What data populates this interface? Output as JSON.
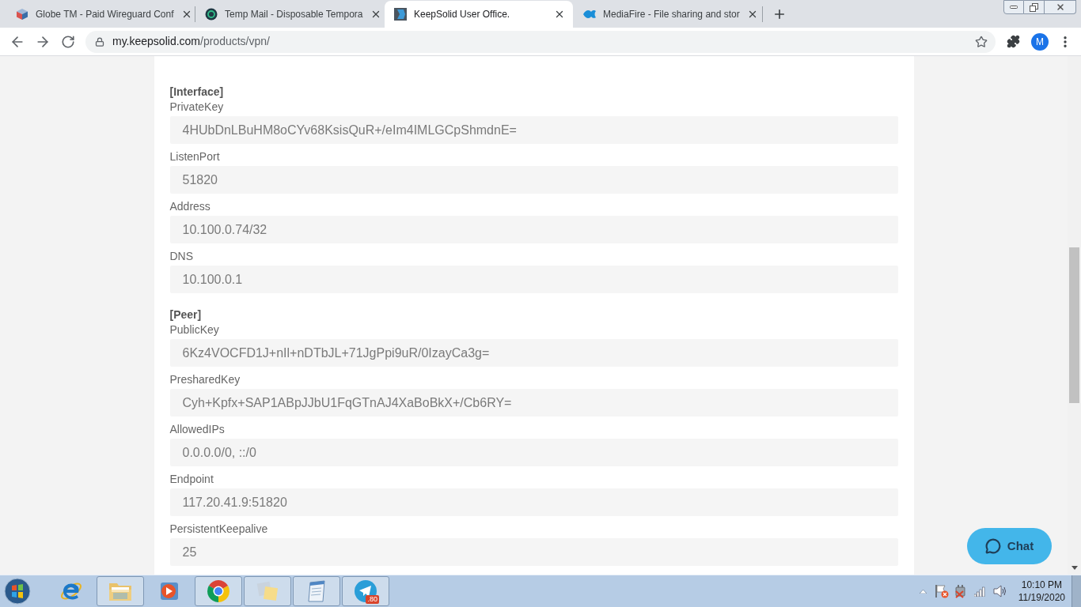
{
  "tabs": [
    {
      "title": "Globe TM - Paid Wireguard Conf",
      "selected": false,
      "kind": "cube"
    },
    {
      "title": "Temp Mail - Disposable Tempora",
      "selected": false,
      "kind": "disc"
    },
    {
      "title": "KeepSolid User Office.",
      "selected": true,
      "kind": "tile"
    },
    {
      "title": "MediaFire - File sharing and stor",
      "selected": false,
      "kind": "flame"
    }
  ],
  "address_bar": {
    "host": "my.keepsolid.com",
    "path": "/products/vpn/"
  },
  "profile": {
    "initial": "M"
  },
  "config": {
    "sections": [
      {
        "title": "[Interface]",
        "fields": [
          {
            "label": "PrivateKey",
            "value": "4HUbDnLBuHM8oCYv68KsisQuR+/eIm4IMLGCpShmdnE="
          },
          {
            "label": "ListenPort",
            "value": "51820"
          },
          {
            "label": "Address",
            "value": "10.100.0.74/32"
          },
          {
            "label": "DNS",
            "value": "10.100.0.1"
          }
        ]
      },
      {
        "title": "[Peer]",
        "fields": [
          {
            "label": "PublicKey",
            "value": "6Kz4VOCFD1J+nIl+nDTbJL+71JgPpi9uR/0IzayCa3g="
          },
          {
            "label": "PresharedKey",
            "value": "Cyh+Kpfx+SAP1ABpJJbU1FqGTnAJ4XaBoBkX+/Cb6RY="
          },
          {
            "label": "AllowedIPs",
            "value": "0.0.0.0/0, ::/0"
          },
          {
            "label": "Endpoint",
            "value": "117.20.41.9:51820"
          },
          {
            "label": "PersistentKeepalive",
            "value": "25"
          }
        ]
      }
    ]
  },
  "chat_button": {
    "label": "Chat"
  },
  "taskbar": {
    "apps": [
      {
        "kind": "ie",
        "running": false
      },
      {
        "kind": "folder",
        "running": true
      },
      {
        "kind": "media",
        "running": false
      },
      {
        "kind": "wheel",
        "running": true
      },
      {
        "kind": "notes",
        "running": true
      },
      {
        "kind": "notepad",
        "running": true
      },
      {
        "kind": "plane",
        "running": true,
        "badge": ".80"
      }
    ],
    "clock": {
      "time": "10:10 PM",
      "date": "11/19/2020"
    }
  }
}
